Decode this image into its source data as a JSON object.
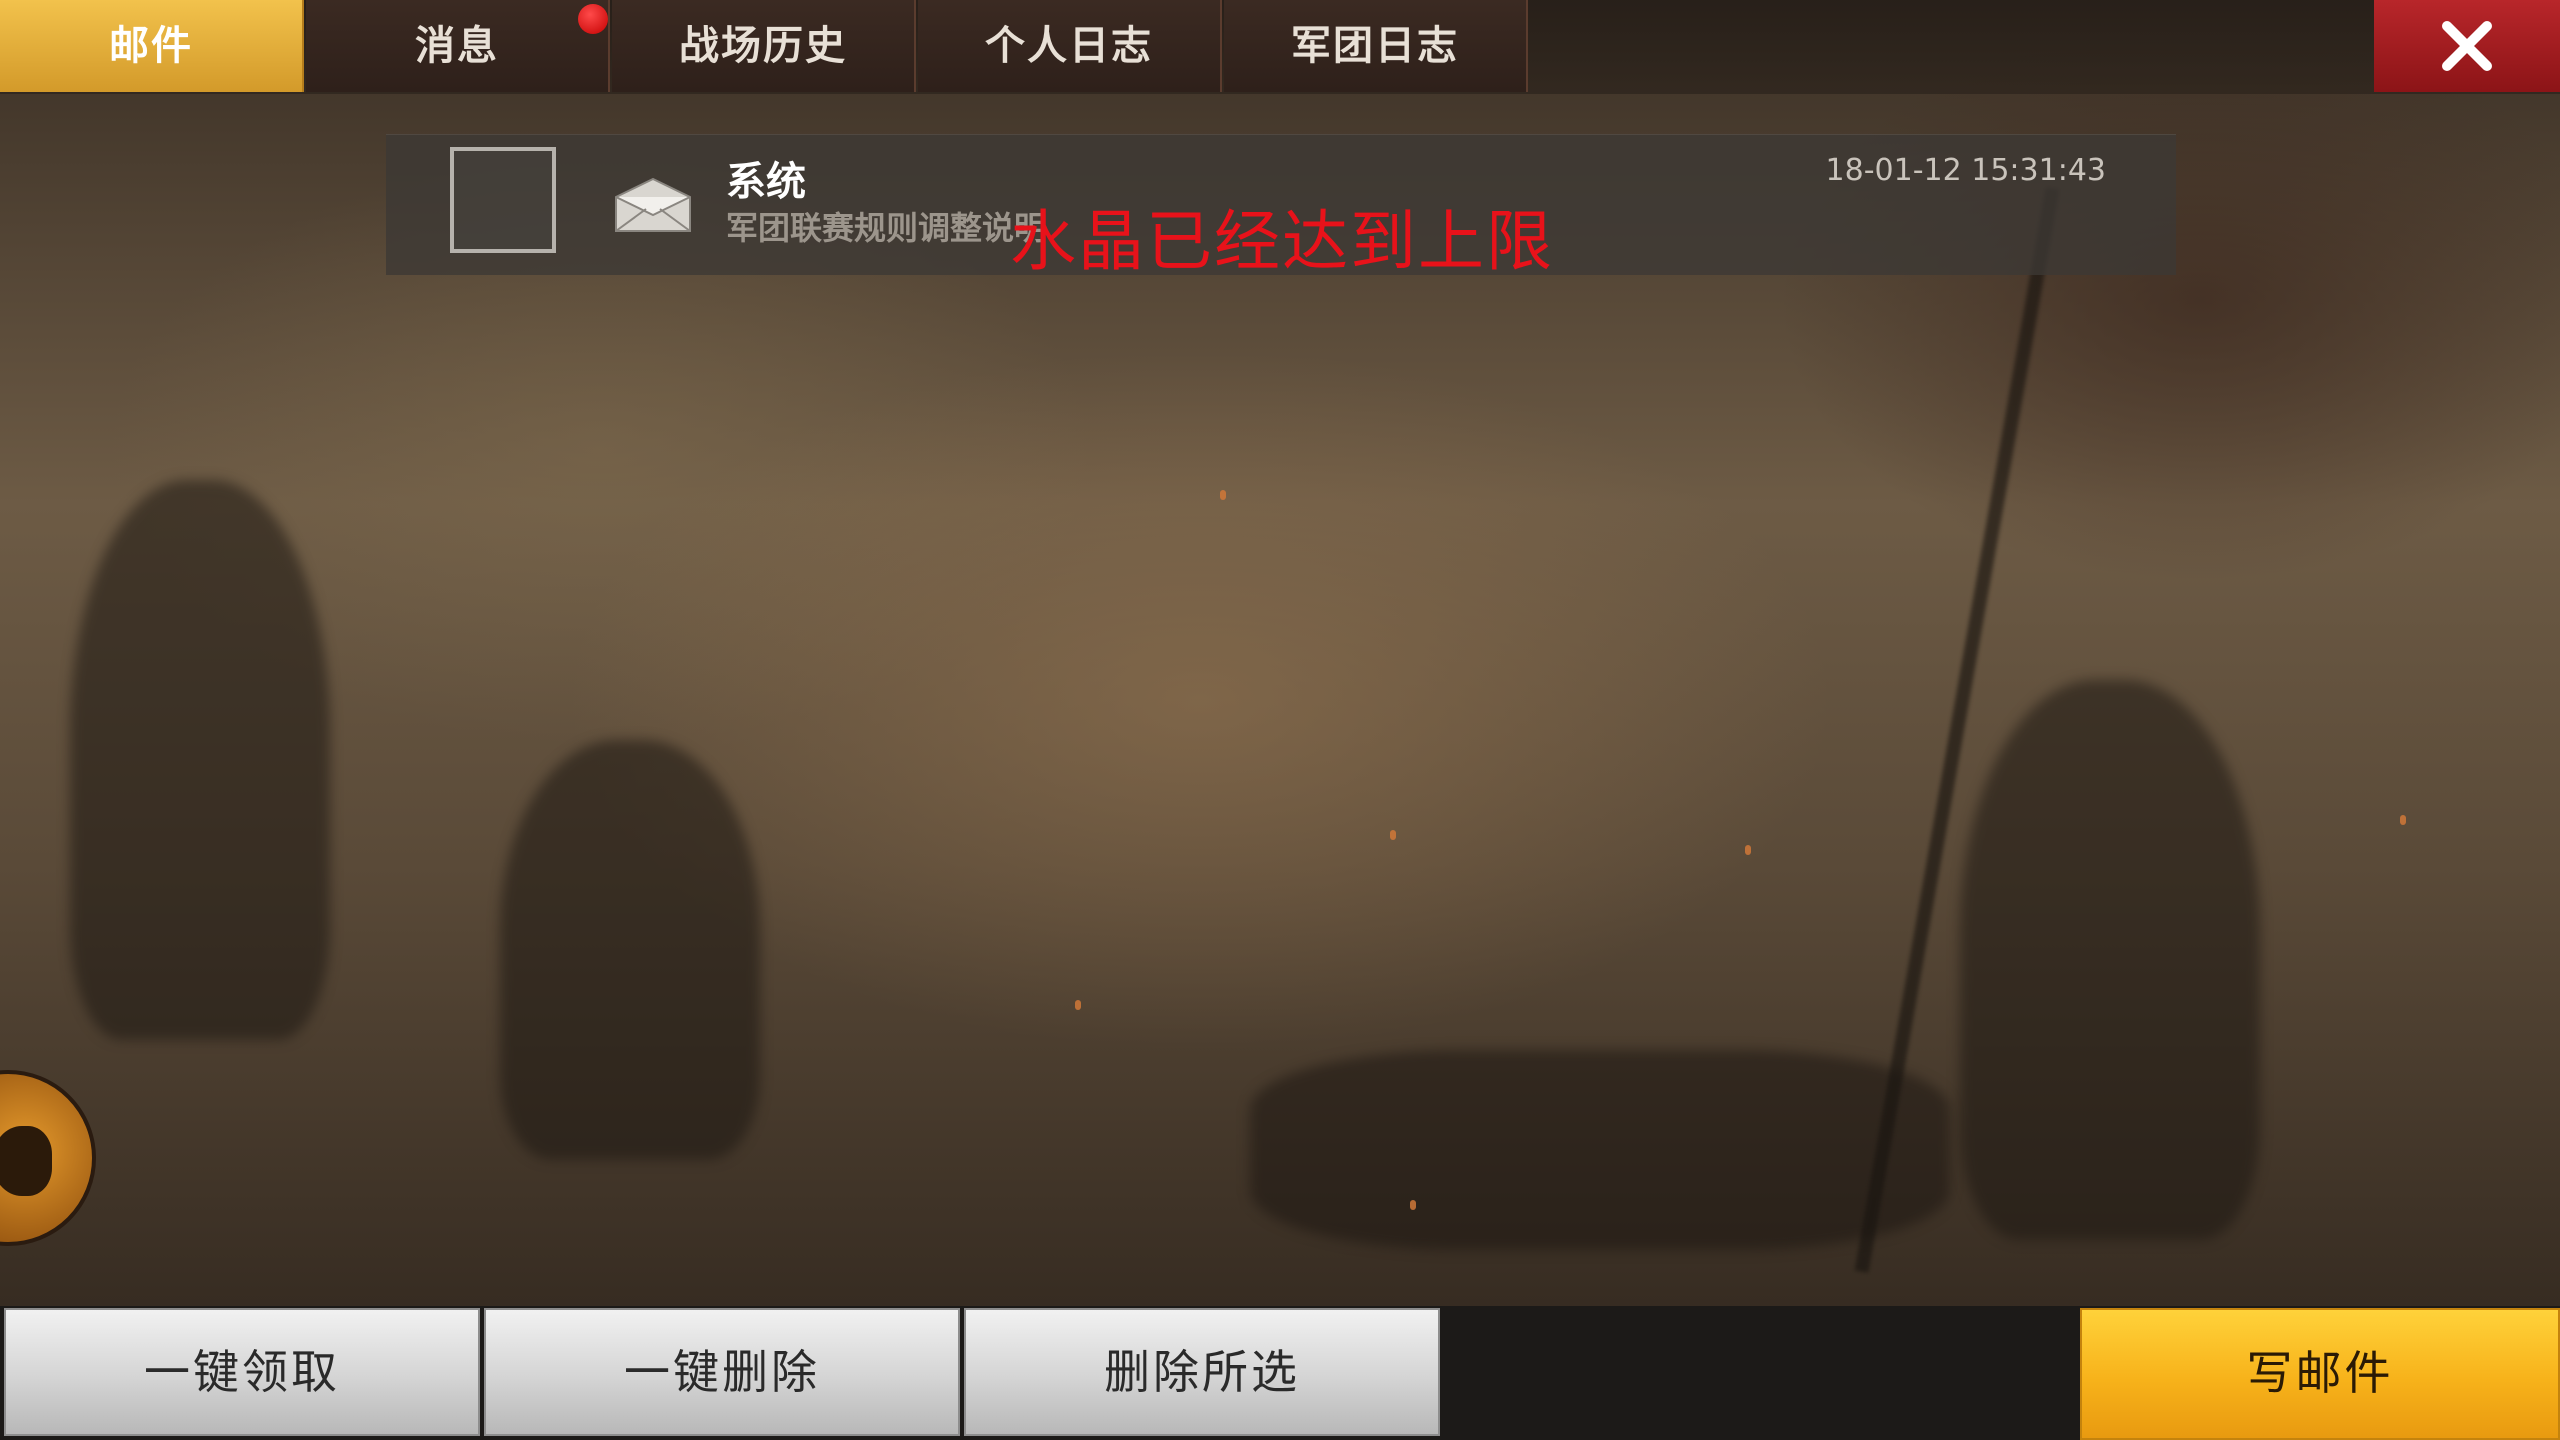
{
  "tabs": [
    {
      "label": "邮件",
      "active": true
    },
    {
      "label": "消息",
      "active": false,
      "has_notification": true
    },
    {
      "label": "战场历史",
      "active": false
    },
    {
      "label": "个人日志",
      "active": false
    },
    {
      "label": "军团日志",
      "active": false
    }
  ],
  "close": {
    "icon": "close-icon"
  },
  "mail": {
    "items": [
      {
        "sender": "系统",
        "subject": "军团联赛规则调整说明",
        "time": "18-01-12 15:31:43",
        "icon": "envelope-open-icon",
        "selected": false
      }
    ]
  },
  "toast": {
    "message": "水晶已经达到上限",
    "color": "#e8121a"
  },
  "actions": {
    "claim_all": "一键领取",
    "delete_all": "一键删除",
    "delete_selected": "删除所选",
    "compose": "写邮件"
  },
  "colors": {
    "active_tab": "#f2c24c",
    "close_button": "#b8262a",
    "compose_button": "#f7b21a"
  }
}
